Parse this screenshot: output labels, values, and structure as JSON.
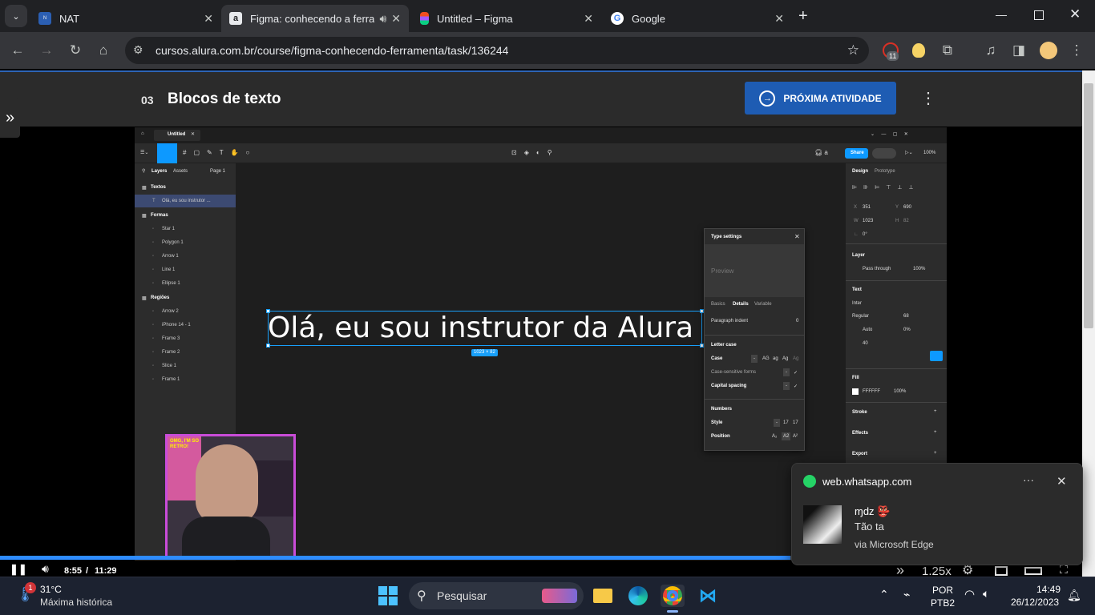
{
  "browser": {
    "tabs": [
      {
        "title": "NAT",
        "icon": "nat-favicon",
        "active": false
      },
      {
        "title": "Figma: conhecendo a ferramenta",
        "icon": "alura-favicon",
        "active": true
      },
      {
        "title": "Untitled – Figma",
        "icon": "figma-favicon",
        "active": false
      },
      {
        "title": "Google",
        "icon": "google-favicon",
        "active": false
      }
    ],
    "new_tab": "+",
    "url": "cursos.alura.com.br/course/figma-conhecendo-ferramenta/task/136244",
    "extension_badge": "11"
  },
  "page": {
    "activity_number": "03",
    "activity_title": "Blocos de texto",
    "next_button": "PRÓXIMA ATIVIDADE"
  },
  "figma": {
    "file_tab": "Untitled",
    "share_button": "Share",
    "zoom": "100%",
    "left_tabs": [
      "Layers",
      "Assets"
    ],
    "page_selector": "Page 1",
    "layers": [
      {
        "label": "Textos",
        "type": "section"
      },
      {
        "label": "Olá, eu sou instrutor ...",
        "type": "text",
        "selected": true
      },
      {
        "label": "Formas",
        "type": "section"
      },
      {
        "label": "Star 1",
        "type": "item"
      },
      {
        "label": "Polygon 1",
        "type": "item"
      },
      {
        "label": "Arrow 1",
        "type": "item"
      },
      {
        "label": "Line 1",
        "type": "item"
      },
      {
        "label": "Ellipse 1",
        "type": "item"
      },
      {
        "label": "Regiões",
        "type": "section"
      },
      {
        "label": "Arrow 2",
        "type": "item"
      },
      {
        "label": "iPhone 14 - 1",
        "type": "item"
      },
      {
        "label": "Frame 3",
        "type": "item"
      },
      {
        "label": "Frame 2",
        "type": "item"
      },
      {
        "label": "Slice 1",
        "type": "item"
      },
      {
        "label": "Frame 1",
        "type": "item"
      }
    ],
    "canvas_text": "Olá, eu sou instrutor da Alura",
    "selection_size": "1023 × 82",
    "type_settings": {
      "title": "Type settings",
      "preview": "Preview",
      "tabs": [
        "Basics",
        "Details",
        "Variable"
      ],
      "paragraph_indent_label": "Paragraph indent",
      "paragraph_indent": "0",
      "letter_case_heading": "Letter case",
      "case_label": "Case",
      "case_options": [
        "-",
        "AG",
        "ag",
        "Ag",
        "Ag"
      ],
      "case_sensitive_label": "Case-sensitive forms",
      "capital_spacing_label": "Capital spacing",
      "numbers_heading": "Numbers",
      "style_label": "Style",
      "style_options": [
        "-",
        "17",
        "17"
      ],
      "position_label": "Position",
      "position_options": [
        "A₂",
        "A2",
        "A²"
      ]
    },
    "right_tabs": [
      "Design",
      "Prototype"
    ],
    "x": "351",
    "y": "690",
    "w": "1023",
    "h": "82",
    "rotation": "0°",
    "layer_heading": "Layer",
    "blend": "Pass through",
    "layer_opacity": "100%",
    "text_heading": "Text",
    "font": "Inter",
    "font_weight": "Regular",
    "font_size": "68",
    "line_height": "Auto",
    "letter_spacing": "0%",
    "paragraph_spacing": "40",
    "fill_heading": "Fill",
    "fill_hex": "FFFFFF",
    "fill_opacity": "100%",
    "stroke_heading": "Stroke",
    "effects_heading": "Effects",
    "export_heading": "Export"
  },
  "webcam": {
    "poster_text": "OMG, I'M SO RETRO!"
  },
  "video": {
    "current_time": "8:55",
    "separator": "/",
    "duration": "11:29",
    "speed": "1.25x",
    "progress_fraction": 0.73
  },
  "notification": {
    "source": "web.whatsapp.com",
    "sender": "ɱdz 👺",
    "message": "Tão ta",
    "via": "via Microsoft Edge"
  },
  "taskbar": {
    "weather_temp": "31°C",
    "weather_desc": "Máxima histórica",
    "weather_badge": "1",
    "search_placeholder": "Pesquisar",
    "lang_1": "POR",
    "lang_2": "PTB2",
    "time": "14:49",
    "date": "26/12/2023"
  },
  "colors": {
    "accent": "#1e5cb3",
    "figma_select": "#18a0fb",
    "webcam_border": "#c94cd8"
  }
}
